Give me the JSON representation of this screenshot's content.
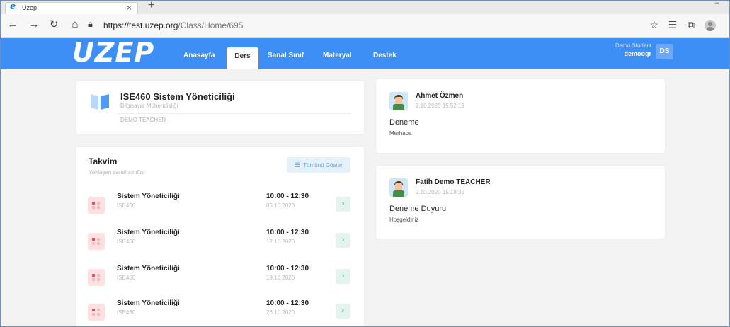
{
  "browser": {
    "tab_title": "Uzep",
    "url_host": "https://test.uzep.org",
    "url_path": "/Class/Home/695"
  },
  "site": {
    "logo": "UZEP",
    "nav": [
      "Anasayfa",
      "Ders",
      "Sanal Sınıf",
      "Materyal",
      "Destek"
    ],
    "active_nav": "Ders",
    "user": {
      "display_name": "Demo Student",
      "login": "demoogr",
      "initials": "DS"
    },
    "brand_color": "#3d8ef5"
  },
  "course": {
    "title": "ISE460 Sistem Yöneticiliği",
    "department": "Bilgisayar Mühendisliği",
    "teacher": "DEMO TEACHER"
  },
  "calendar": {
    "title": "Takvim",
    "subtitle": "Yaklaşan sanal sınıflar",
    "show_all": "Tümünü Göster",
    "items": [
      {
        "name": "Sistem Yöneticiliği",
        "code": "ISE460",
        "time": "10:00 - 12:30",
        "date": "05.10.2020"
      },
      {
        "name": "Sistem Yöneticiliği",
        "code": "ISE460",
        "time": "10:00 - 12:30",
        "date": "12.10.2020"
      },
      {
        "name": "Sistem Yöneticiliği",
        "code": "ISE460",
        "time": "10:00 - 12:30",
        "date": "19.10.2020"
      },
      {
        "name": "Sistem Yöneticiliği",
        "code": "ISE460",
        "time": "10:00 - 12:30",
        "date": "26.10.2020"
      }
    ]
  },
  "announcements": [
    {
      "author": "Ahmet Özmen",
      "datetime": "2.10.2020 15:52:19",
      "title": "Deneme",
      "body": "Merhaba"
    },
    {
      "author": "Fatih Demo TEACHER",
      "datetime": "2.10.2020 15:18:35",
      "title": "Deneme Duyuru",
      "body": "Hoşgeldiniz"
    }
  ]
}
